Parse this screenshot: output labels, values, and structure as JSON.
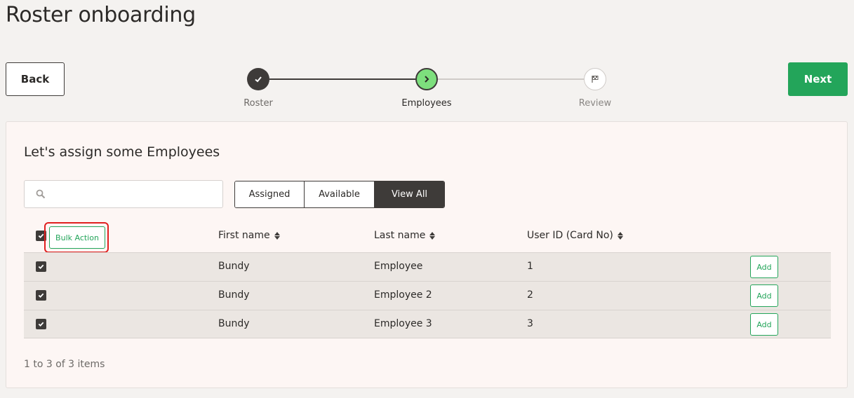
{
  "page": {
    "title": "Roster onboarding"
  },
  "nav": {
    "back_label": "Back",
    "next_label": "Next"
  },
  "stepper": {
    "steps": [
      {
        "label": "Roster",
        "state": "done",
        "icon": "check-icon"
      },
      {
        "label": "Employees",
        "state": "current",
        "icon": "chevron-right-icon"
      },
      {
        "label": "Review",
        "state": "todo",
        "icon": "flag-icon"
      }
    ]
  },
  "card": {
    "title": "Let's assign some Employees",
    "search": {
      "placeholder": "",
      "value": "",
      "icon": "search-icon"
    },
    "filters": {
      "assigned": "Assigned",
      "available": "Available",
      "view_all": "View All",
      "active": "View All"
    }
  },
  "table": {
    "bulk_action_label": "Bulk Action",
    "columns": {
      "first_name": "First name",
      "last_name": "Last name",
      "user_id": "User ID (Card No)"
    },
    "rows": [
      {
        "first": "Bundy",
        "last": "Employee",
        "id": "1",
        "action": "Add",
        "checked": true
      },
      {
        "first": "Bundy",
        "last": "Employee 2",
        "id": "2",
        "action": "Add",
        "checked": true
      },
      {
        "first": "Bundy",
        "last": "Employee 3",
        "id": "3",
        "action": "Add",
        "checked": true
      }
    ]
  },
  "pager": {
    "summary": "1 to 3 of 3 items"
  },
  "colors": {
    "accent_green": "#23a55a",
    "dark": "#3e3b39",
    "highlight_red": "#e02020",
    "step_current": "#7ddf7d"
  }
}
